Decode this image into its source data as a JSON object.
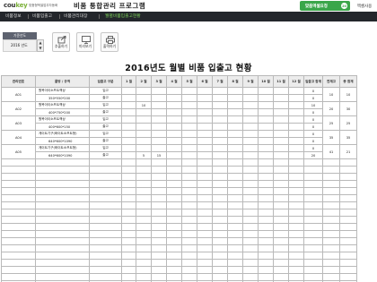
{
  "header": {
    "logo_main": "cou",
    "logo_key": "key",
    "tagline": "맞춤형엑셀업무자동화",
    "app_title": "비품 통합관리 프로그램",
    "custom_button_label": "맞춤엑셀요청",
    "custom_button_badge": "20",
    "excel_button_label": "엑셀사용",
    "accent_color": "#3aa64a"
  },
  "tabs": [
    {
      "label": "비품정보"
    },
    {
      "label": "비품입출고"
    },
    {
      "label": "비품관리대장"
    },
    {
      "label": "월별비품입출고현황"
    }
  ],
  "toolbar": {
    "year_label": "기준년도",
    "year_value": "2016 년도",
    "buttons": [
      {
        "label": "추출하기",
        "icon": "export-icon"
      },
      {
        "label": "미리보기",
        "icon": "monitor-icon"
      },
      {
        "label": "출력하기",
        "icon": "printer-icon"
      }
    ]
  },
  "report": {
    "title": "2016년도 월별 비품 입출고 현황"
  },
  "table": {
    "headers": [
      "관리번호",
      "품명 / 규격",
      "입출고 구분",
      "1 월",
      "2 월",
      "3 월",
      "4 월",
      "5 월",
      "6 월",
      "7 월",
      "8 월",
      "9 월",
      "10 월",
      "11 월",
      "12 월",
      "입출고 합계",
      "전재고",
      "총 합계"
    ],
    "items": [
      {
        "code": "A01",
        "name": "원목아이소프트책상",
        "spec": "350*550*200",
        "in": [
          "",
          "",
          "",
          "",
          "",
          "",
          "",
          "",
          "",
          "",
          "",
          ""
        ],
        "out": [
          "",
          "",
          "",
          "",
          "",
          "",
          "",
          "",
          "",
          "",
          "",
          ""
        ],
        "in_total": "0",
        "out_total": "0",
        "prev": "10",
        "total": "10"
      },
      {
        "code": "A02",
        "name": "원목아이소프트책상",
        "spec": "400*750*200",
        "in": [
          "",
          "10",
          "",
          "",
          "",
          "",
          "",
          "",
          "",
          "",
          "",
          ""
        ],
        "out": [
          "",
          "",
          "",
          "",
          "",
          "",
          "",
          "",
          "",
          "",
          "",
          ""
        ],
        "in_total": "10",
        "out_total": "0",
        "prev": "20",
        "total": "30"
      },
      {
        "code": "A03",
        "name": "원목아이소프트책상",
        "spec": "400*600*150",
        "in": [
          "",
          "",
          "",
          "",
          "",
          "",
          "",
          "",
          "",
          "",
          "",
          ""
        ],
        "out": [
          "",
          "",
          "",
          "",
          "",
          "",
          "",
          "",
          "",
          "",
          "",
          ""
        ],
        "in_total": "0",
        "out_total": "0",
        "prev": "25",
        "total": "25"
      },
      {
        "code": "A04",
        "name": "게이트기구(화이트소프트형)",
        "spec": "640*600*1090",
        "in": [
          "",
          "",
          "",
          "",
          "",
          "",
          "",
          "",
          "",
          "",
          "",
          ""
        ],
        "out": [
          "",
          "",
          "",
          "",
          "",
          "",
          "",
          "",
          "",
          "",
          "",
          ""
        ],
        "in_total": "0",
        "out_total": "0",
        "prev": "35",
        "total": "35"
      },
      {
        "code": "A05",
        "name": "게이트기구(화이트소프트형)",
        "spec": "640*600*1090",
        "in": [
          "",
          "",
          "",
          "",
          "",
          "",
          "",
          "",
          "",
          "",
          "",
          ""
        ],
        "out": [
          "",
          "5",
          "15",
          "",
          "",
          "",
          "",
          "",
          "",
          "",
          "",
          ""
        ],
        "in_total": "0",
        "out_total": "20",
        "prev": "41",
        "total": "21"
      }
    ],
    "in_label": "입고",
    "out_label": "출고",
    "blank_rows": 18
  }
}
